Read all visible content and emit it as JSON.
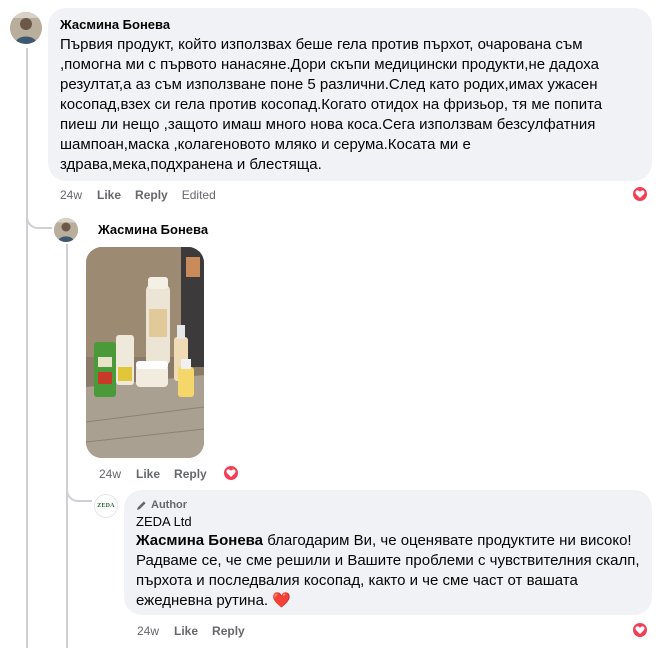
{
  "comment1": {
    "author": "Жасмина Бонева",
    "text": "Първия продукт, който използвах беше гела против пърхот, очарована съм ,помогна ми с първото нанасяне.Дори скъпи медицински продукти,не дадоха резултат,а аз съм използване поне 5 различни.След като родих,имах ужасен косопад,взех си гела против косопад.Когато отидох на фризьор, тя ме попита пиеш ли нещо ,защото имаш много нова коса.Сега използвам безсулфатния шампоан,маска ,колагеновото мляко и серума.Косата ми е здрава,мека,подхранена и блестяща.",
    "time": "24w",
    "like": "Like",
    "reply": "Reply",
    "edited": "Edited"
  },
  "comment2": {
    "author": "Жасмина Бонева",
    "time": "24w",
    "like": "Like",
    "reply": "Reply"
  },
  "comment3": {
    "badge": "Author",
    "author": "ZEDA Ltd",
    "mention": "Жасмина Бонева",
    "text": " благодарим Ви, че оценявате продуктите ни високо! Радваме се, че сме решили и Вашите проблеми с чувствителния скалп, пърхота и последвалия косопад, както и че сме част от вашата ежедневна рутина. ❤️",
    "logo_text": "ZEDA",
    "time": "24w",
    "like": "Like",
    "reply": "Reply"
  },
  "colors": {
    "bubble": "#f0f2f5",
    "heart": "#f33e58",
    "meta": "#65676b"
  }
}
